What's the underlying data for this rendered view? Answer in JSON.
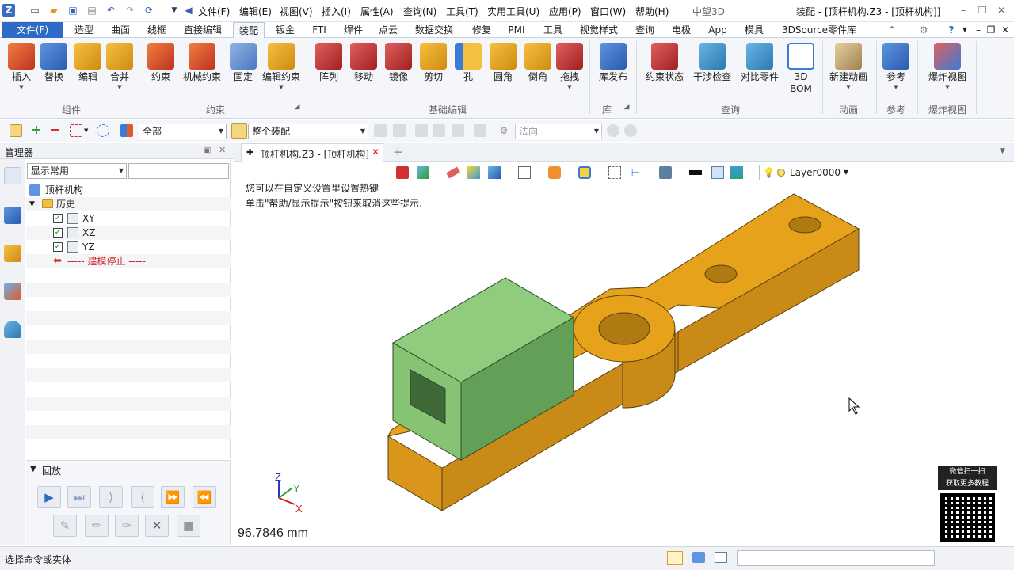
{
  "title_bar": {
    "menu": [
      "文件(F)",
      "编辑(E)",
      "视图(V)",
      "插入(I)",
      "属性(A)",
      "查询(N)",
      "工具(T)",
      "实用工具(U)",
      "应用(P)",
      "窗口(W)",
      "帮助(H)"
    ],
    "app_name": "中望3D",
    "window_title": "装配 - [顶杆机构.Z3 - [顶杆机构]]"
  },
  "ribbon_tabs": [
    "文件(F)",
    "造型",
    "曲面",
    "线框",
    "直接编辑",
    "装配",
    "钣金",
    "FTI",
    "焊件",
    "点云",
    "数据交换",
    "修复",
    "PMI",
    "工具",
    "视觉样式",
    "查询",
    "电极",
    "App",
    "模具",
    "3DSource零件库"
  ],
  "ribbon": {
    "buttons": [
      {
        "label": "插入",
        "color": "#e05a2a"
      },
      {
        "label": "替换",
        "color": "#3a7bd5"
      },
      {
        "label": "编辑",
        "color": "#e0a020"
      },
      {
        "label": "合并",
        "color": "#e0a020"
      },
      {
        "label": "约束",
        "color": "#e05a2a"
      },
      {
        "label": "机械约束",
        "color": "#e05a2a"
      },
      {
        "label": "固定",
        "color": "#5a8fd0"
      },
      {
        "label": "编辑约束",
        "color": "#e0a020"
      },
      {
        "label": "阵列",
        "color": "#d03a3a"
      },
      {
        "label": "移动",
        "color": "#d03a3a"
      },
      {
        "label": "镜像",
        "color": "#d03a3a"
      },
      {
        "label": "剪切",
        "color": "#e0a020"
      },
      {
        "label": "孔",
        "color": "#e0a020"
      },
      {
        "label": "圆角",
        "color": "#e0a020"
      },
      {
        "label": "倒角",
        "color": "#e0a020"
      },
      {
        "label": "拖拽",
        "color": "#d03a3a"
      },
      {
        "label": "库发布",
        "color": "#3a7bd5"
      },
      {
        "label": "约束状态",
        "color": "#d03a3a"
      },
      {
        "label": "干涉检查",
        "color": "#3a9bd5"
      },
      {
        "label": "对比零件",
        "color": "#3a9bd5"
      },
      {
        "label": "3D BOM",
        "color": "#3a7bd5"
      },
      {
        "label": "新建动画",
        "color": "#c8a060"
      },
      {
        "label": "参考",
        "color": "#3a7bd5"
      },
      {
        "label": "爆炸视图",
        "color": "#d03a3a"
      }
    ],
    "groups": [
      "组件",
      "约束",
      "基础编辑",
      "库",
      "查询",
      "动画",
      "参考",
      "爆炸视图"
    ]
  },
  "toolbar2": {
    "filter": "全部",
    "scope": "整个装配",
    "direction": "法向"
  },
  "manager": {
    "title": "管理器",
    "display_filter": "显示常用",
    "tree": {
      "root": "顶杆机构",
      "history": "历史",
      "planes": [
        "XY",
        "XZ",
        "YZ"
      ],
      "stop_marker": "----- 建模停止 -----"
    },
    "playback_title": "回放"
  },
  "viewport": {
    "doc_tab": "顶杆机构.Z3 - [顶杆机构]",
    "layer": "Layer0000",
    "hint_line1": "您可以在自定义设置里设置热键",
    "hint_line2": "单击\"帮助/显示提示\"按钮来取消这些提示.",
    "measurement": "96.7846 mm",
    "axis_z": "Z",
    "axis_y": "Y",
    "axis_x": "X",
    "qr_line1": "微信扫一扫",
    "qr_line2": "获取更多教程"
  },
  "status": {
    "text": "选择命令或实体"
  },
  "colors": {
    "accent": "#2e6bc6",
    "part_gold": "#e6a21a",
    "part_green": "#8fcc7e"
  }
}
